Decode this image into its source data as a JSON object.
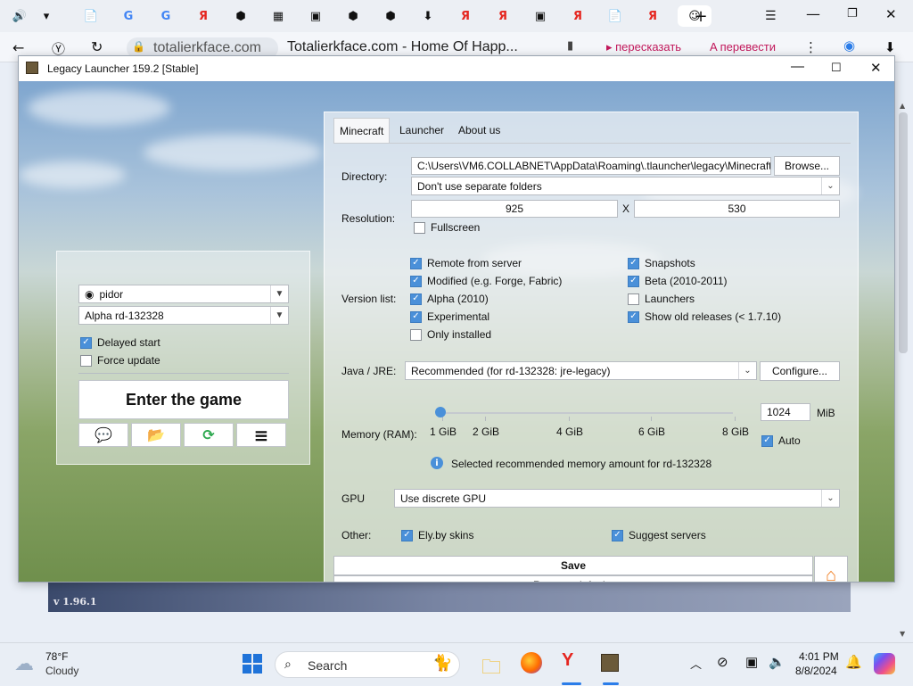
{
  "browser": {
    "tabs": [
      "🔊",
      "▾",
      "📄",
      "G",
      "G",
      "Я",
      "⬢",
      "▦",
      "▣",
      "⬢",
      "⬢",
      "⬇",
      "Я",
      "Я",
      "▣",
      "Я",
      "📄",
      "Я",
      "☺"
    ],
    "new_tab": "+",
    "url": "totalierkface.com",
    "page_title": "Totalierkface.com - Home Of Happ...",
    "ext_retell": "пересказать",
    "ext_translate": "перевести",
    "version_footer": "v 1.96.1"
  },
  "window": {
    "title": "Legacy Launcher 159.2 [Stable]"
  },
  "left_panel": {
    "account": "pidor",
    "version": "Alpha rd-132328",
    "delayed_start": "Delayed start",
    "force_update": "Force update",
    "enter_button": "Enter the game"
  },
  "settings": {
    "tabs": [
      "Minecraft",
      "Launcher",
      "About us"
    ],
    "directory_label": "Directory:",
    "directory_value": "C:\\Users\\VM6.COLLABNET\\AppData\\Roaming\\.tlauncher\\legacy\\Minecraft",
    "browse": "Browse...",
    "folders_option": "Don't use separate folders",
    "resolution_label": "Resolution:",
    "res_width": "925",
    "res_x": "X",
    "res_height": "530",
    "fullscreen": "Fullscreen",
    "version_list_label": "Version list:",
    "version_opts_left": [
      "Remote from server",
      "Modified (e.g. Forge, Fabric)",
      "Alpha (2010)",
      "Experimental",
      "Only installed"
    ],
    "version_opts_right": [
      "Snapshots",
      "Beta (2010-2011)",
      "Launchers",
      "Show old releases (< 1.7.10)"
    ],
    "java_label": "Java / JRE:",
    "java_value": "Recommended (for rd-132328: jre-legacy)",
    "configure": "Configure...",
    "memory_label": "Memory (RAM):",
    "memory_ticks": [
      "1 GiB",
      "2 GiB",
      "4 GiB",
      "6 GiB",
      "8 GiB"
    ],
    "memory_value": "1024",
    "memory_unit": "MiB",
    "auto": "Auto",
    "memory_info": "Selected recommended memory amount for rd-132328",
    "gpu_label": "GPU",
    "gpu_value": "Use discrete GPU",
    "other_label": "Other:",
    "ely_skins": "Ely.by skins",
    "suggest_servers": "Suggest servers",
    "save": "Save",
    "reset": "Reset to defaults"
  },
  "taskbar": {
    "temp": "78°F",
    "weather": "Cloudy",
    "search": "Search",
    "time": "4:01 PM",
    "date": "8/8/2024"
  },
  "colors": {
    "accent": "#4a90d9",
    "home_orange": "#f07a1a"
  }
}
